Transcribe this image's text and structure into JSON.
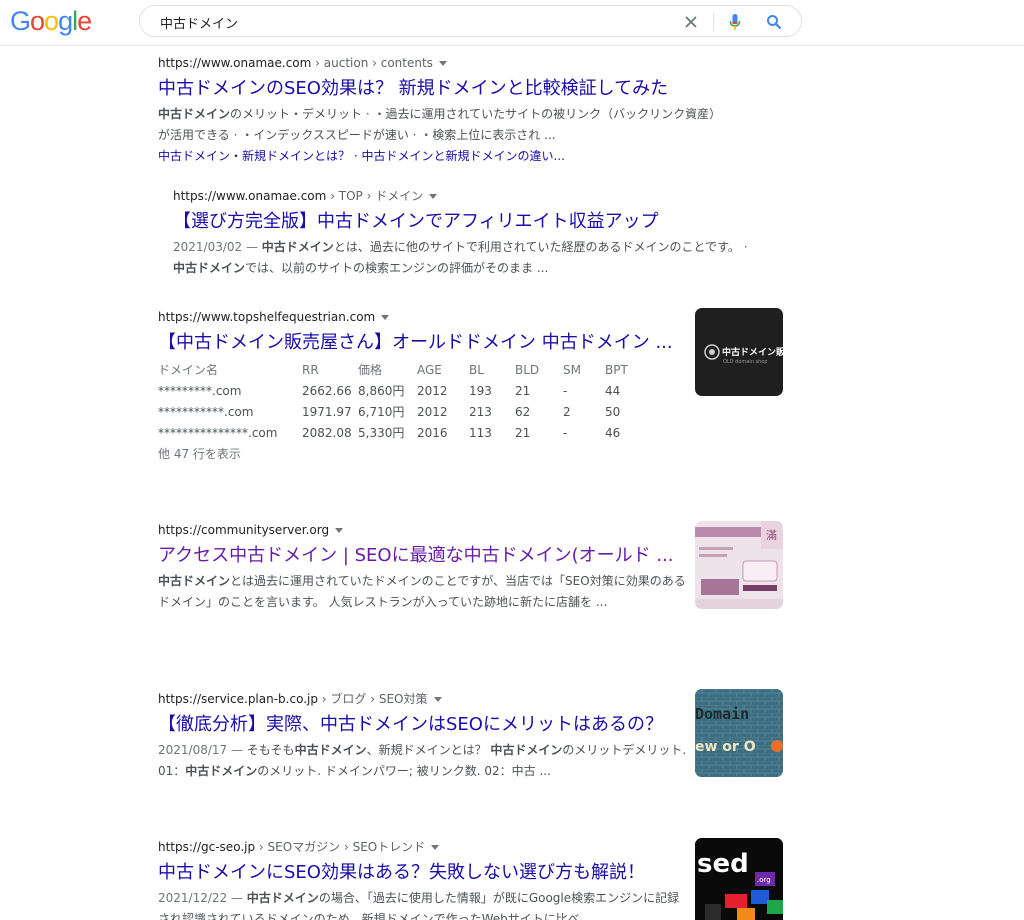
{
  "logo": {
    "text": "Google",
    "letters": [
      "G",
      "o",
      "o",
      "g",
      "l",
      "e"
    ],
    "colors": [
      "#4285f4",
      "#ea4335",
      "#fbbc05",
      "#4285f4",
      "#34a853",
      "#ea4335"
    ]
  },
  "search": {
    "query": "中古ドメイン"
  },
  "icons": {
    "clear": "close-icon",
    "voice": "microphone-icon",
    "search": "search-icon"
  },
  "results": [
    {
      "url": "https://www.onamae.com",
      "crumbs": " › auction › contents",
      "title": "中古ドメインのSEO効果は？ 新規ドメインと比較検証してみた",
      "snippet_parts": [
        "中古ドメイン",
        "のメリット・デメリット · ・過去に運用されていたサイトの被リンク（バックリンク資産）が活用できる · ・インデックススピードが速い · ・検索上位に表示され ..."
      ],
      "sitelinks": "中古ドメイン・新規ドメインとは？ · 中古ドメインと新規ドメインの違い..."
    },
    {
      "url": "https://www.onamae.com",
      "crumbs": " › TOP › ドメイン",
      "title": "【選び方完全版】中古ドメインでアフィリエイト収益アップ",
      "date": "2021/03/02 — ",
      "snippet_html_parts": [
        "中古ドメイン",
        "とは、過去に他のサイトで利用されていた経歴のあるドメインのことです。 · ",
        "中古ドメイン",
        "では、以前のサイトの検索エンジンの評価がそのまま ..."
      ]
    },
    {
      "url": "https://www.topshelfequestrian.com",
      "crumbs": "",
      "title": "【中古ドメイン販売屋さん】オールドドメイン 中古ドメイン ...",
      "table": {
        "headers": [
          "ドメイン名",
          "RR",
          "価格",
          "AGE",
          "BL",
          "BLD",
          "SM",
          "BPT"
        ],
        "rows": [
          [
            "*********.com",
            "2662.66",
            "8,860円",
            "2012",
            "193",
            "21",
            "-",
            "44"
          ],
          [
            "***********.com",
            "1971.97",
            "6,710円",
            "2012",
            "213",
            "62",
            "2",
            "50"
          ],
          [
            "***************.com",
            "2082.08",
            "5,330円",
            "2016",
            "113",
            "21",
            "-",
            "46"
          ]
        ],
        "more": "他 47 行を表示"
      },
      "thumb": {
        "label": "中古ドメイン販売",
        "sub": "OLD domain shop"
      }
    },
    {
      "url": "https://communityserver.org",
      "crumbs": "",
      "title": "アクセス中古ドメイン | SEOに最適な中古ドメイン(オールド ...",
      "snippet_parts": [
        "中古ドメイン",
        "とは過去に運用されていたドメインのことですが、当店では「SEO対策に効果のあるドメイン」のことを言います。 人気レストランが入っていた跡地に新たに店舗を ..."
      ],
      "thumb": {
        "label": "滿"
      }
    },
    {
      "url": "https://service.plan-b.co.jp",
      "crumbs": " › ブログ › SEO対策",
      "title": "【徹底分析】実際、中古ドメインはSEOにメリットはあるの？",
      "date": "2021/08/17 — ",
      "snippet_html_parts": [
        "そもそも",
        "中古ドメイン",
        "、新規ドメインとは？ ",
        "中古ドメイン",
        "のメリットデメリット. 01：",
        "中古ドメイン",
        "のメリット. ドメインパワー; 被リンク数. 02：中古 ..."
      ],
      "thumb": {
        "label": "Domain",
        "sub": "ew or O"
      }
    },
    {
      "url": "https://gc-seo.jp",
      "crumbs": " › SEOマガジン › SEOトレンド",
      "title": "中古ドメインにSEO効果はある？失敗しない選び方も解説！",
      "date": "2021/12/22 — ",
      "snippet_html_parts": [
        "中古ドメイン",
        "の場合、「過去に使用した情報」が既にGoogle検索エンジンに記録され認識されているドメインのため、新規ドメインで作ったWebサイトに比べ"
      ],
      "thumb": {
        "label": "sed",
        "sub": ".org"
      }
    }
  ]
}
